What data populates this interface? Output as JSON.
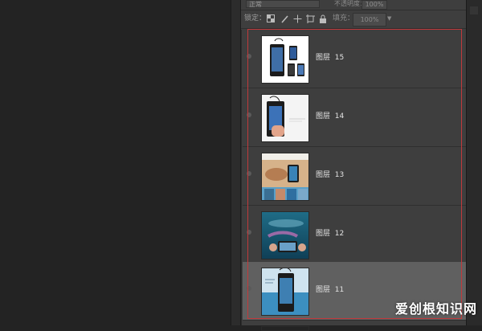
{
  "blend_mode": {
    "label": "正常"
  },
  "opacity": {
    "label": "不透明度：",
    "value": "100%"
  },
  "lock": {
    "label": "锁定："
  },
  "fill": {
    "label": "填充：",
    "value": "100%"
  },
  "layers": [
    {
      "name": "图层",
      "number": "15",
      "selected": false
    },
    {
      "name": "图层",
      "number": "14",
      "selected": false
    },
    {
      "name": "图层",
      "number": "13",
      "selected": false
    },
    {
      "name": "图层",
      "number": "12",
      "selected": false
    },
    {
      "name": "图层",
      "number": "11",
      "selected": true
    }
  ],
  "watermark": {
    "text": "爱创根知识网"
  },
  "colors": {
    "highlight": "#c0393b",
    "selected_row": "#606060",
    "panel_bg": "#3e3e3e"
  }
}
